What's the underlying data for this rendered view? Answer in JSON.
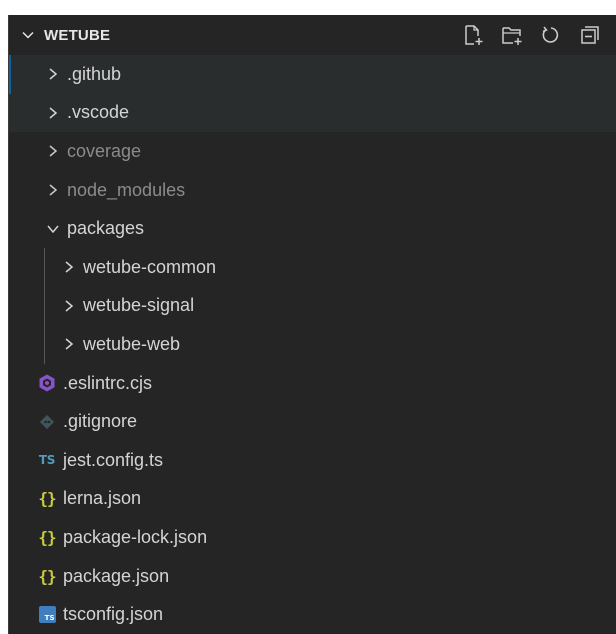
{
  "explorer": {
    "section_title": "WETUBE",
    "actions": [
      "new-file",
      "new-folder",
      "refresh",
      "collapse-all"
    ]
  },
  "tree": {
    "folders_top": [
      {
        "label": ".github",
        "expanded": false,
        "dim": false
      },
      {
        "label": ".vscode",
        "expanded": false,
        "dim": false
      },
      {
        "label": "coverage",
        "expanded": false,
        "dim": true
      },
      {
        "label": "node_modules",
        "expanded": false,
        "dim": true
      },
      {
        "label": "packages",
        "expanded": true,
        "dim": false
      }
    ],
    "packages_children": [
      {
        "label": "wetube-common"
      },
      {
        "label": "wetube-signal"
      },
      {
        "label": "wetube-web"
      }
    ],
    "files": [
      {
        "label": ".eslintrc.cjs",
        "icon": "eslint-icon"
      },
      {
        "label": ".gitignore",
        "icon": "git-icon"
      },
      {
        "label": "jest.config.ts",
        "icon": "typescript-icon",
        "badge": "TS"
      },
      {
        "label": "lerna.json",
        "icon": "json-icon",
        "badge": "{}"
      },
      {
        "label": "package-lock.json",
        "icon": "json-icon",
        "badge": "{}"
      },
      {
        "label": "package.json",
        "icon": "json-icon",
        "badge": "{}"
      },
      {
        "label": "tsconfig.json",
        "icon": "tsconfig-icon",
        "badge": "TS"
      }
    ]
  },
  "colors": {
    "background": "#252526",
    "text": "#d4d4d4",
    "dim_text": "#8b8b8b",
    "json_yellow": "#cbcb41",
    "ts_blue": "#519aba",
    "eslint_purple": "#8a54c9"
  }
}
